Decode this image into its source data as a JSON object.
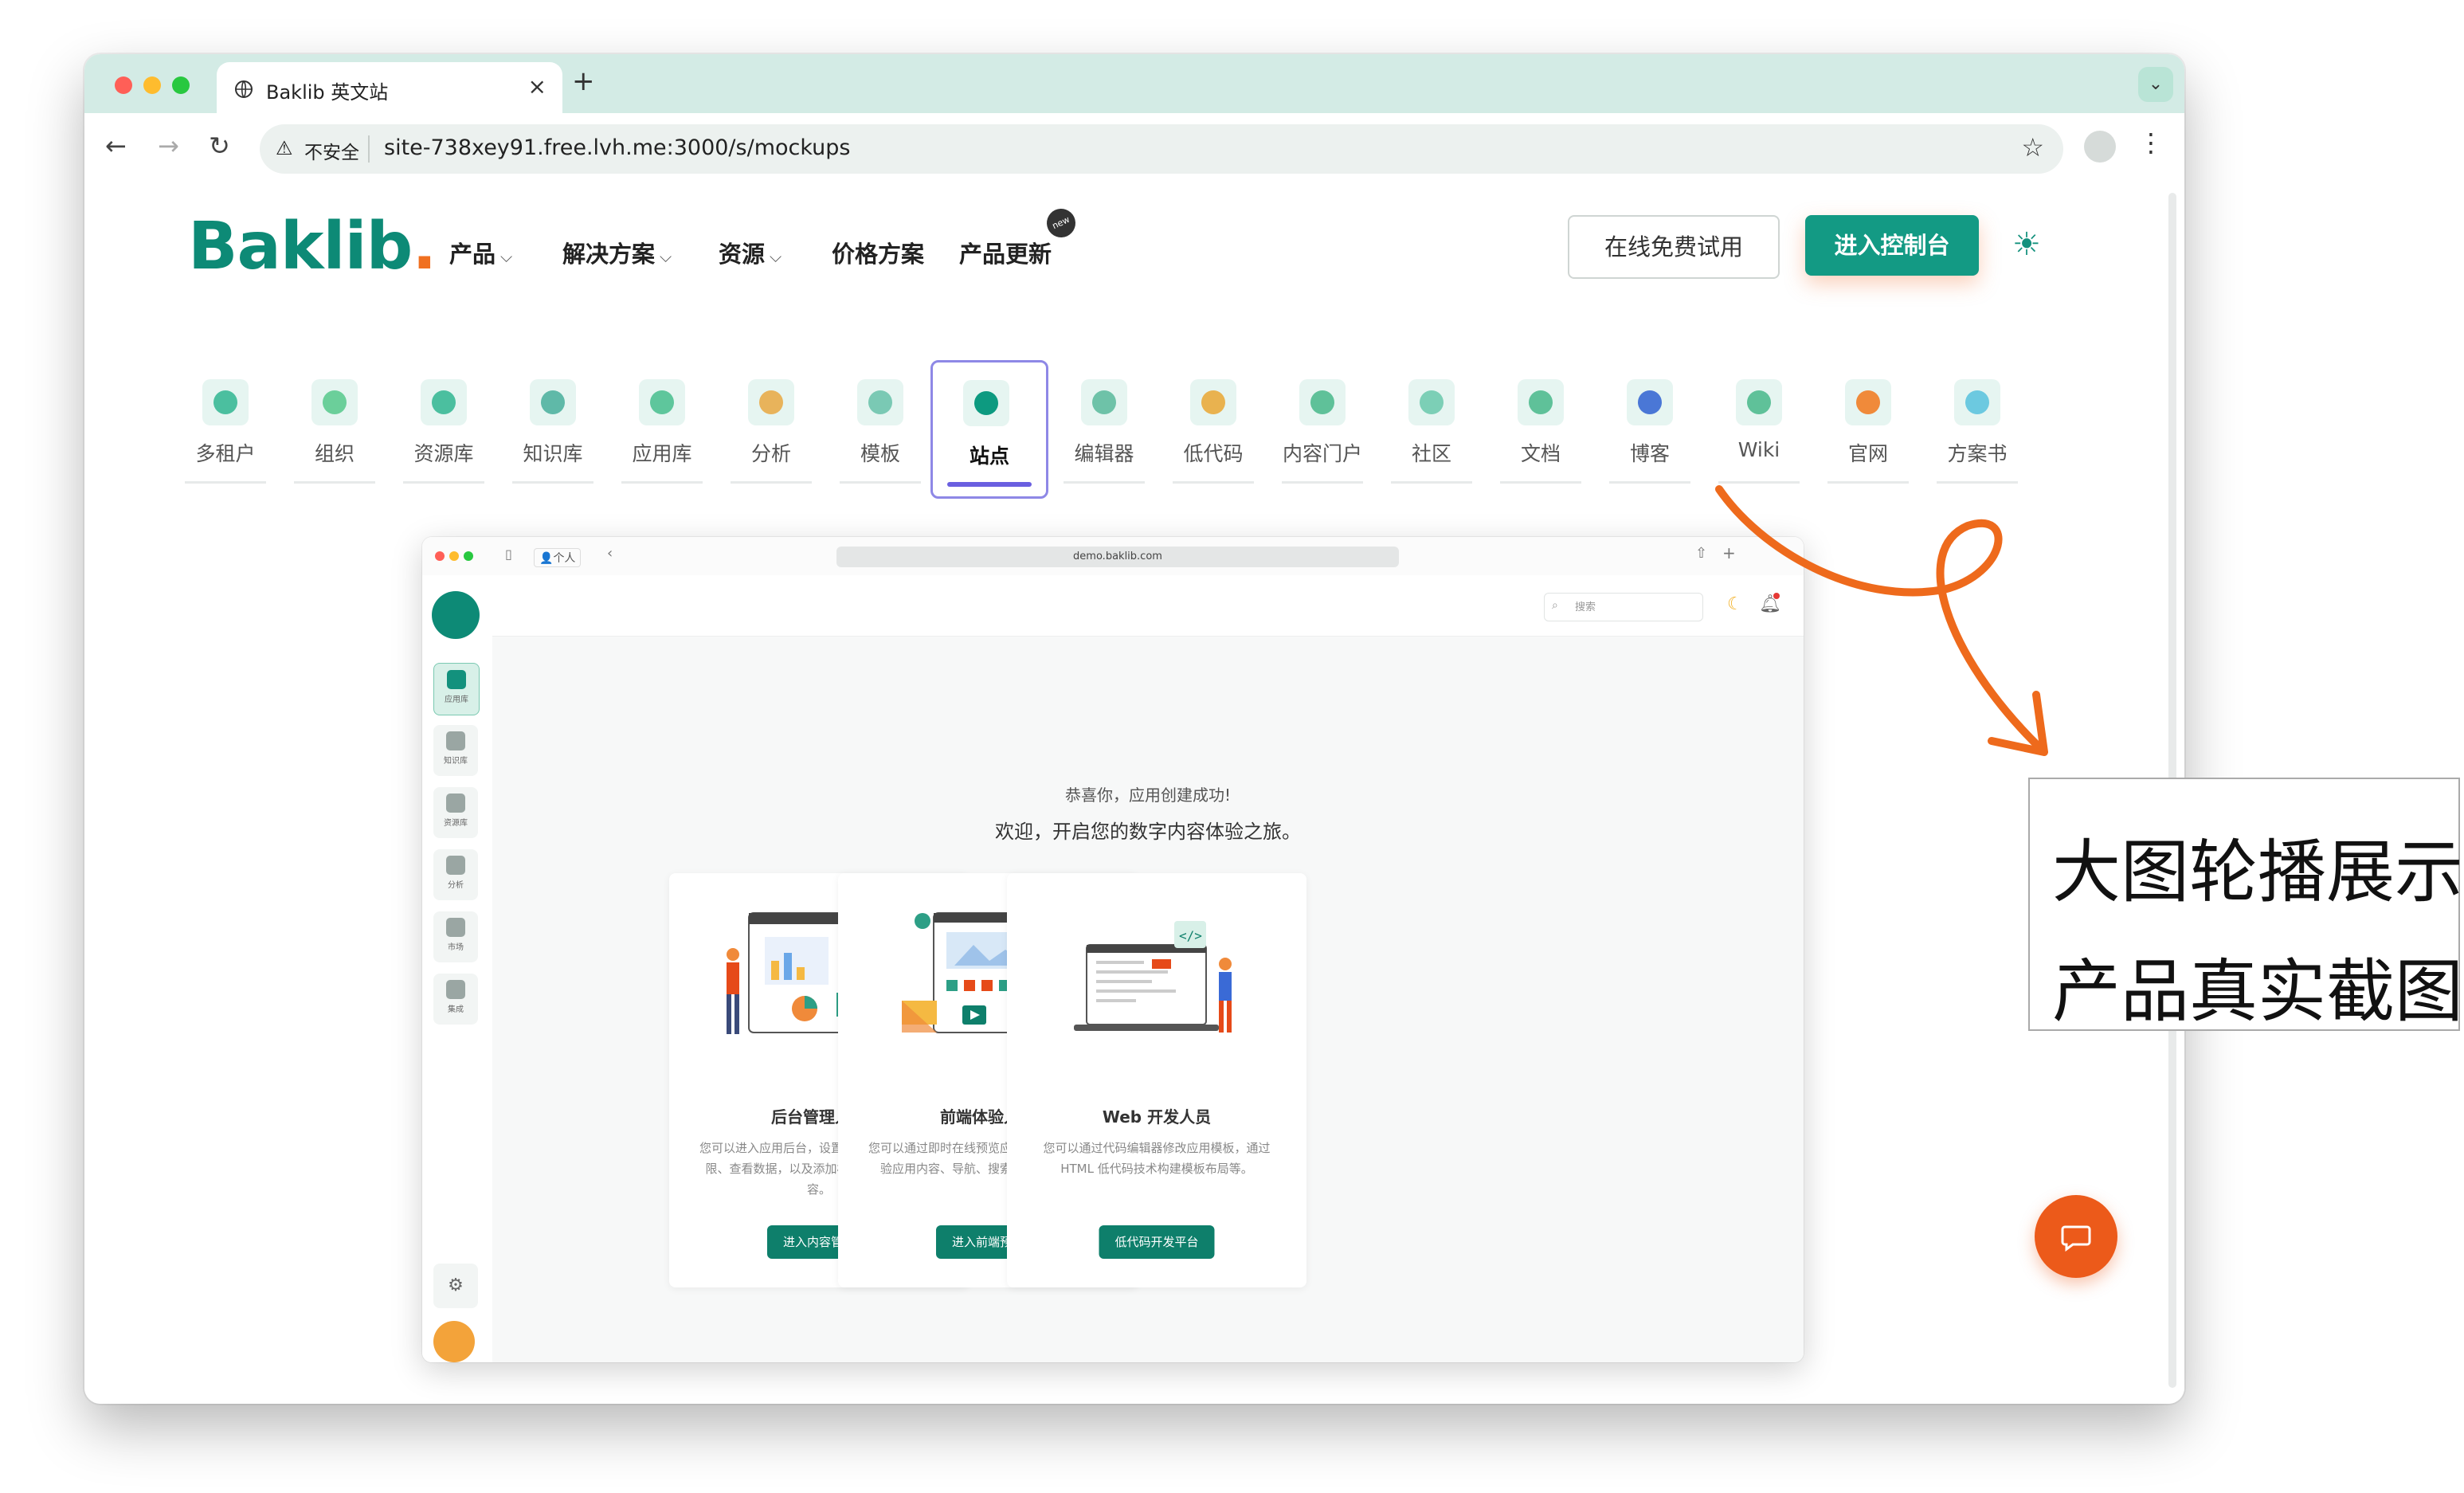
{
  "browser": {
    "tab_title": "Baklib 英文站",
    "tab_close": "×",
    "new_tab": "+",
    "security_label": "不安全",
    "url": "site-738xey91.free.lvh.me:3000/s/mockups"
  },
  "site": {
    "logo": "Baklib",
    "logo_dot": ".",
    "nav": [
      {
        "label": "产品",
        "has_dropdown": true
      },
      {
        "label": "解决方案",
        "has_dropdown": true
      },
      {
        "label": "资源",
        "has_dropdown": true
      },
      {
        "label": "价格方案",
        "has_dropdown": false
      },
      {
        "label": "产品更新",
        "has_dropdown": false
      }
    ],
    "new_badge": "new",
    "trial_button": "在线免费试用",
    "console_button": "进入控制台"
  },
  "categories": [
    {
      "label": "多租户",
      "icon": "bird-icon",
      "color": "#4bbf9f"
    },
    {
      "label": "组织",
      "icon": "cc-icon",
      "color": "#6bcf9a"
    },
    {
      "label": "资源库",
      "icon": "box-icon",
      "color": "#4bbf9f"
    },
    {
      "label": "知识库",
      "icon": "e-icon",
      "color": "#5fb9a8"
    },
    {
      "label": "应用库",
      "icon": "puzzle-icon",
      "color": "#5ec69c"
    },
    {
      "label": "分析",
      "icon": "chart-icon",
      "color": "#e8b35b"
    },
    {
      "label": "模板",
      "icon": "paperclip-icon",
      "color": "#7ac9b4"
    },
    {
      "label": "站点",
      "icon": "pin-icon",
      "color": "#0d9a80",
      "active": true
    },
    {
      "label": "编辑器",
      "icon": "marker-icon",
      "color": "#6ec2a8"
    },
    {
      "label": "低代码",
      "icon": "rails-icon",
      "color": "#e9b24f"
    },
    {
      "label": "内容门户",
      "icon": "bell-icon",
      "color": "#5fc199"
    },
    {
      "label": "社区",
      "icon": "download-icon",
      "color": "#7ccfb6"
    },
    {
      "label": "文档",
      "icon": "atom-icon",
      "color": "#5fc199"
    },
    {
      "label": "博客",
      "icon": "circles-icon",
      "color": "#4a77d6"
    },
    {
      "label": "Wiki",
      "icon": "shield-icon",
      "color": "#5fc199"
    },
    {
      "label": "官网",
      "icon": "ring-icon",
      "color": "#f08a3a"
    },
    {
      "label": "方案书",
      "icon": "network-icon",
      "color": "#6cc9e0"
    }
  ],
  "mock": {
    "address": "demo.baklib.com",
    "personal": "个人",
    "search_placeholder": "搜索",
    "sidebar": [
      {
        "label": "应用库",
        "active": true
      },
      {
        "label": "知识库"
      },
      {
        "label": "资源库"
      },
      {
        "label": "分析"
      },
      {
        "label": "市场"
      },
      {
        "label": "集成"
      }
    ],
    "congrats": "恭喜你，应用创建成功!",
    "welcome": "欢迎，开启您的数字内容体验之旅。",
    "cards": [
      {
        "title": "后台管理人员",
        "desc": "您可以进入应用后台，设置应用信息、修改权限、查看数据，以及添加模板页面、网页内容。",
        "button": "进入内容管理"
      },
      {
        "title": "前端体验人员",
        "desc": "您可以通过即时在线预览应用站点，多终端体验应用内容、导航、搜索以及相关功能。",
        "button": "进入前端预览"
      },
      {
        "title": "Web 开发人员",
        "desc": "您可以通过代码编辑器修改应用模板，通过 HTML 低代码技术构建模板布局等。",
        "button": "低代码开发平台"
      }
    ]
  },
  "annotation": {
    "line1": "大图轮播展示",
    "line2": "产品真实截图"
  },
  "colors": {
    "brand": "#139a84",
    "accent_orange": "#ec5a1a",
    "tab_active_underline": "#6a5fe0"
  }
}
